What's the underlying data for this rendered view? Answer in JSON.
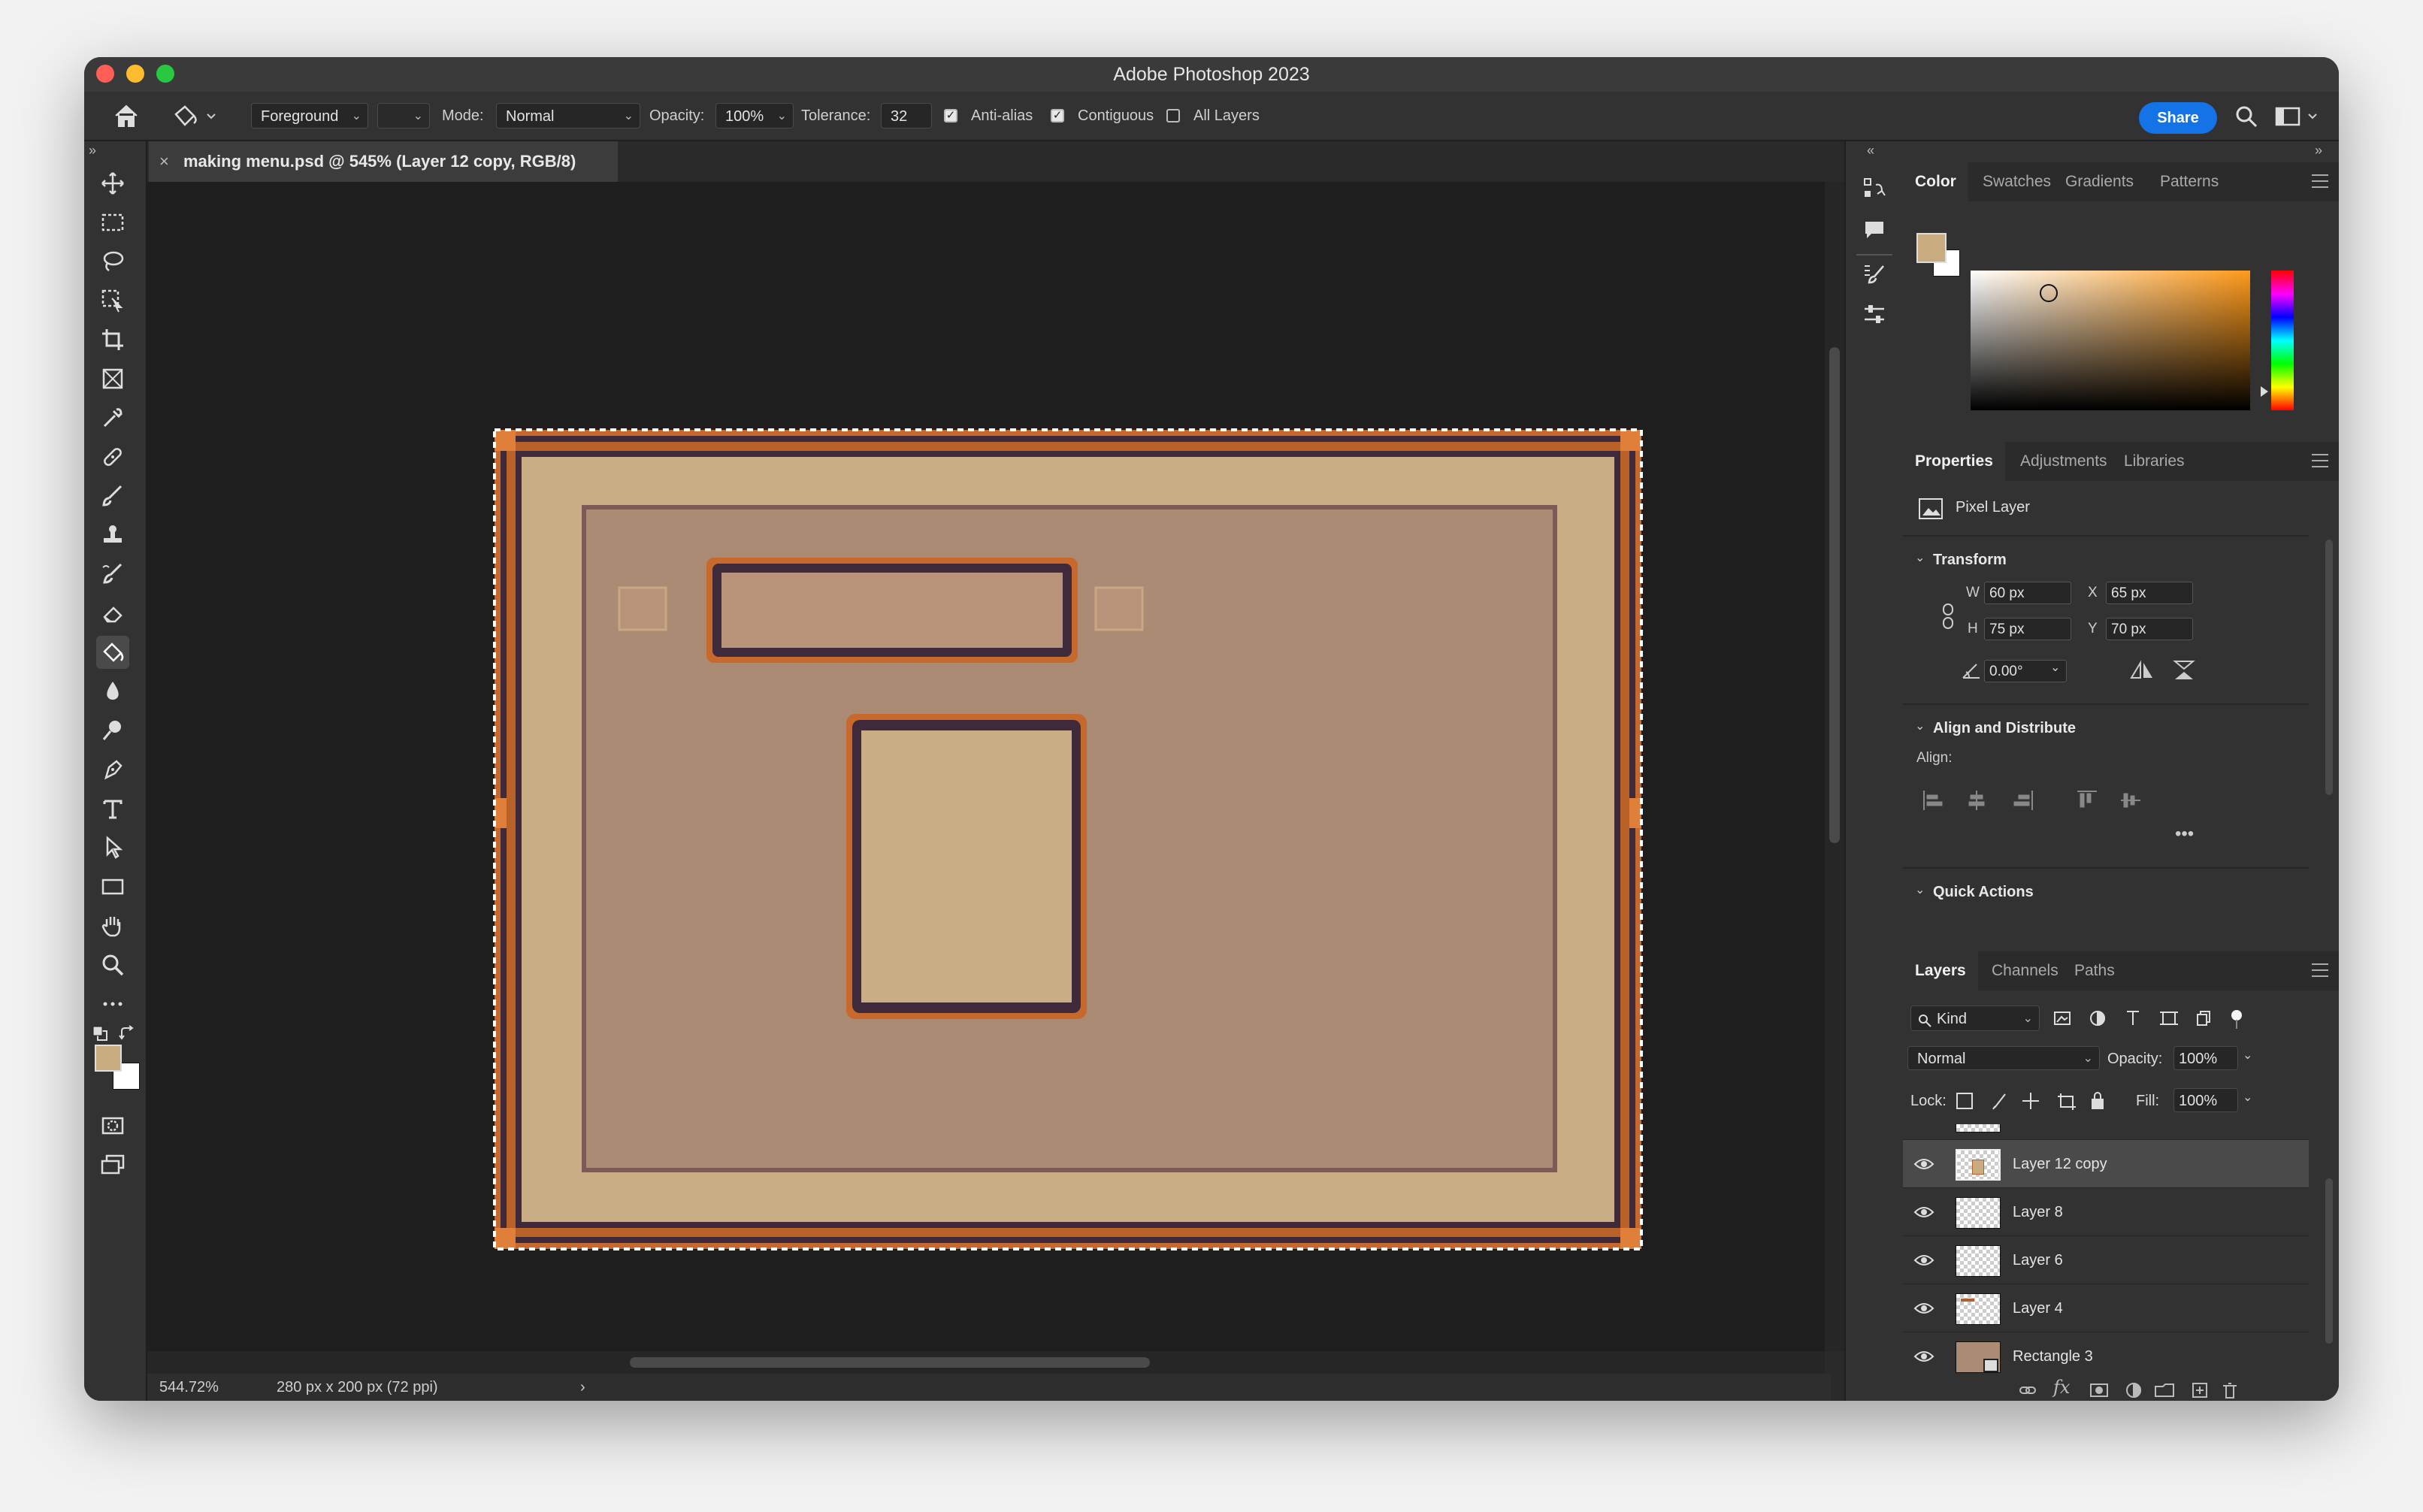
{
  "window": {
    "title": "Adobe Photoshop 2023"
  },
  "options_bar": {
    "fill_source": "Foreground",
    "mode_label": "Mode:",
    "mode_value": "Normal",
    "opacity_label": "Opacity:",
    "opacity_value": "100%",
    "tolerance_label": "Tolerance:",
    "tolerance_value": "32",
    "antialias_label": "Anti-alias",
    "contiguous_label": "Contiguous",
    "all_layers_label": "All Layers",
    "share_label": "Share"
  },
  "document": {
    "tab_title": "making menu.psd @ 545% (Layer 12 copy, RGB/8)",
    "zoom": "544.72%",
    "doc_info": "280 px x 200 px (72 ppi)"
  },
  "color_panel": {
    "tabs": [
      "Color",
      "Swatches",
      "Gradients",
      "Patterns"
    ],
    "foreground_color": "#c8ab7e",
    "background_color": "#ffffff",
    "hue_color": "#ff9a1a"
  },
  "properties_panel": {
    "tabs": [
      "Properties",
      "Adjustments",
      "Libraries"
    ],
    "layer_type": "Pixel Layer",
    "transform_title": "Transform",
    "w_label": "W",
    "w_value": "60 px",
    "x_label": "X",
    "x_value": "65 px",
    "h_label": "H",
    "h_value": "75 px",
    "y_label": "Y",
    "y_value": "70 px",
    "angle_value": "0.00°",
    "align_title": "Align and Distribute",
    "align_label": "Align:",
    "quick_actions_title": "Quick Actions"
  },
  "layers_panel": {
    "tabs": [
      "Layers",
      "Channels",
      "Paths"
    ],
    "filter_kind": "Kind",
    "blend_mode": "Normal",
    "opacity_label": "Opacity:",
    "opacity_value": "100%",
    "lock_label": "Lock:",
    "fill_label": "Fill:",
    "fill_value": "100%",
    "layers": [
      {
        "name": "Layer 12 copy",
        "selected": true
      },
      {
        "name": "Layer 8",
        "selected": false
      },
      {
        "name": "Layer 6",
        "selected": false
      },
      {
        "name": "Layer 4",
        "selected": false
      },
      {
        "name": "Rectangle 3",
        "selected": false
      }
    ]
  },
  "artwork_colors": {
    "outer_frame": "#c7692c",
    "outer_panel": "#c9ad84",
    "inner_panel": "#ab8b73",
    "dark_outline": "#3e2a3a"
  }
}
